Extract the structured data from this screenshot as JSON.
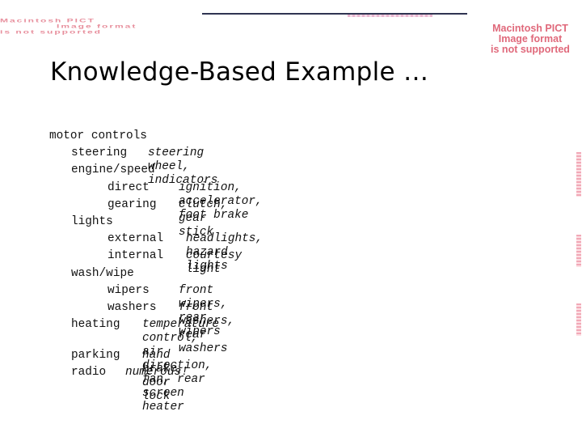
{
  "placeholders": {
    "left": [
      "Macintosh PICT",
      "Image format",
      "is not supported"
    ],
    "right": [
      "Macintosh PICT",
      "Image format",
      "is not supported"
    ]
  },
  "slide": {
    "title": "Knowledge-Based Example …"
  },
  "tree": {
    "root": "motor controls",
    "steering": {
      "term": "steering",
      "desc": "steering wheel, indicators"
    },
    "engine": {
      "term": "engine/speed"
    },
    "direct": {
      "term": "direct",
      "desc": "ignition, accelerator, foot brake"
    },
    "gearing": {
      "term": "gearing",
      "desc": "clutch, gear stick"
    },
    "lights": {
      "term": "lights"
    },
    "external": {
      "term": "external",
      "desc": "headlights, hazard lights"
    },
    "internal": {
      "term": "internal",
      "desc": "courtesy light"
    },
    "washwipe": {
      "term": "wash/wipe"
    },
    "wipers": {
      "term": "wipers",
      "desc": "front wipers, rear wipers"
    },
    "washers": {
      "term": "washers",
      "desc": "front washers, rear washers"
    },
    "heating": {
      "term": "heating",
      "desc": "temperature control, air direction,\nfan, rear screen heater"
    },
    "parking": {
      "term": "parking",
      "desc": "hand brake, door lock"
    },
    "radio": {
      "term": "radio",
      "desc": "numerous!"
    }
  },
  "colors": {
    "placeholder_text": "#e0697b",
    "rule": "#2f3452"
  }
}
